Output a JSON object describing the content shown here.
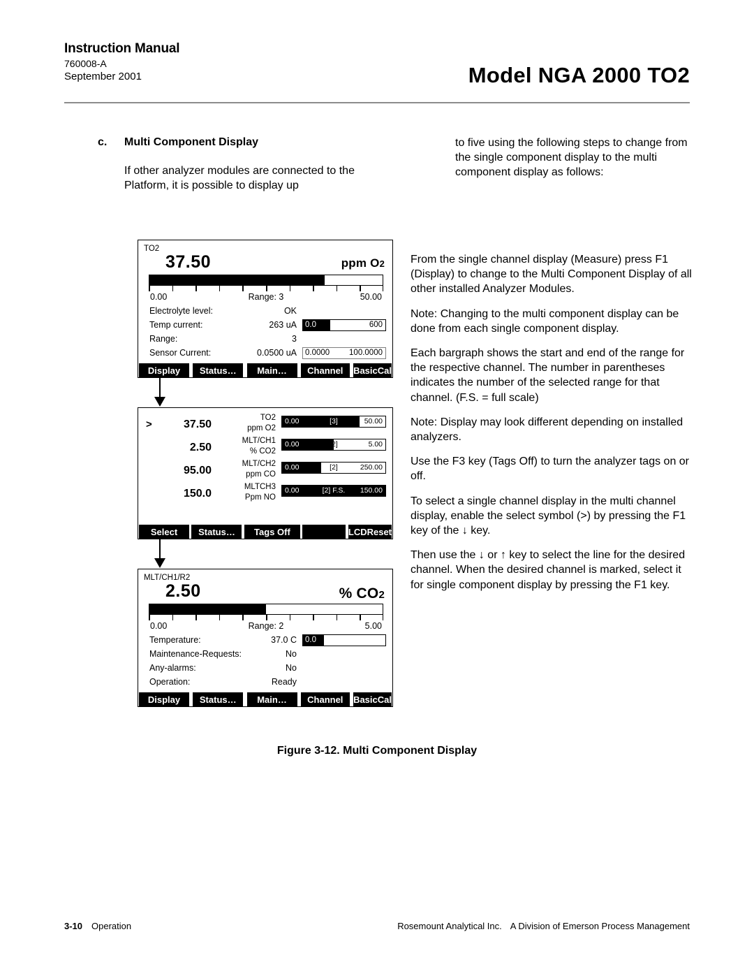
{
  "header": {
    "manual_title": "Instruction Manual",
    "doc_number": "760008-A",
    "date": "September 2001",
    "model": "Model NGA 2000 TO2"
  },
  "section": {
    "letter": "c.",
    "title": "Multi Component Display",
    "left_paragraph": "If other analyzer modules are connected to the Platform, it is possible to display up",
    "right_continuation": "to five using the following steps to change from the single component display to the multi component display as follows:",
    "paragraphs": [
      "From the single channel display (Measure) press F1 (Display) to change to the Multi Component Display of all other installed Analyzer Modules.",
      "Note: Changing to the multi component display can be done from each single component display.",
      "Each bargraph shows the start and end of the range for the respective channel. The number in parentheses indicates the number of the selected range for that channel. (F.S. = full scale)",
      "Note: Display may look different depending on installed analyzers.",
      "Use the F3 key (Tags Off) to turn the analyzer tags on or off.",
      "To select a single channel display in the multi channel display, enable the select symbol (>) by pressing the F1 key of the ↓ key.",
      "Then use the ↓ or ↑ key to select the line for the desired channel. When the desired channel is marked, select it for single component display by pressing the F1 key."
    ]
  },
  "figure": {
    "caption": "Figure 3-12.  Multi Component Display",
    "panel_single_top": {
      "tag": "TO2",
      "value": "37.50",
      "unit_main": "ppm O",
      "unit_sub": "2",
      "bargraph": {
        "fill_percent": 75,
        "low_label": "0.00",
        "mid_label": "Range: 3",
        "high_label": "50.00",
        "tick_count": 10
      },
      "rows": [
        {
          "label": "Electrolyte level:",
          "value": "OK",
          "bar": null
        },
        {
          "label": "Temp current:",
          "value": "263 uA",
          "bar": {
            "fill_percent": 33,
            "low_label": "0.0",
            "high_label": "600",
            "style": "black"
          }
        },
        {
          "label": "Range:",
          "value": "3",
          "bar": null
        },
        {
          "label": "Sensor Current:",
          "value": "0.0500 uA",
          "bar": {
            "fill_percent": 0,
            "low_label": "0.0000",
            "high_label": "100.0000",
            "style": "gray"
          }
        }
      ],
      "softkeys": [
        "Display",
        "Status…",
        "Main…",
        "Channel",
        "BasicCal"
      ]
    },
    "panel_multi": {
      "rows": [
        {
          "selected": ">",
          "value": "37.50",
          "tag_line1": "TO2",
          "tag_line2": "ppm O2",
          "bar": {
            "fill_percent": 75,
            "low_label": "0.00",
            "mid_label": "[3]",
            "high_label": "50.00"
          }
        },
        {
          "selected": "",
          "value": "2.50",
          "tag_line1": "MLT/CH1",
          "tag_line2": "%  CO2",
          "bar": {
            "fill_percent": 50,
            "low_label": "0.00",
            "mid_label": "[2]",
            "high_label": "5.00"
          }
        },
        {
          "selected": "",
          "value": "95.00",
          "tag_line1": "MLT/CH2",
          "tag_line2": "ppm CO",
          "bar": {
            "fill_percent": 38,
            "low_label": "0.00",
            "mid_label": "[2]",
            "high_label": "250.00"
          }
        },
        {
          "selected": "",
          "value": "150.0",
          "tag_line1": "MLTCH3",
          "tag_line2": "Ppm NO",
          "bar": {
            "fill_percent": 100,
            "low_label": "0.00",
            "mid_label": "[2] F.S.",
            "high_label": "150.00"
          }
        }
      ],
      "softkeys": [
        "Select",
        "Status…",
        "Tags Off",
        "",
        "LCDReset"
      ]
    },
    "panel_single_bottom": {
      "tag": "MLT/CH1/R2",
      "value": "2.50",
      "unit_pct": "%",
      "unit_main": "CO",
      "unit_sub": "2",
      "bargraph": {
        "fill_percent": 50,
        "low_label": "0.00",
        "mid_label": "Range: 2",
        "high_label": "5.00",
        "tick_count": 10
      },
      "rows": [
        {
          "label": "Temperature:",
          "value": "37.0 C",
          "bar": {
            "fill_percent": 25,
            "low_label": "0.0",
            "high_label": "",
            "style": "black"
          }
        },
        {
          "label": "Maintenance-Requests:",
          "value": "No",
          "bar": null
        },
        {
          "label": "Any-alarms:",
          "value": "No",
          "bar": null
        },
        {
          "label": "Operation:",
          "value": "Ready",
          "bar": null
        }
      ],
      "softkeys": [
        "Display",
        "Status…",
        "Main…",
        "Channel",
        "BasicCal"
      ]
    }
  },
  "footer": {
    "page_number": "3-10",
    "section_name": "Operation",
    "company": "Rosemount Analytical Inc.",
    "division": "A Division of Emerson Process Management"
  }
}
